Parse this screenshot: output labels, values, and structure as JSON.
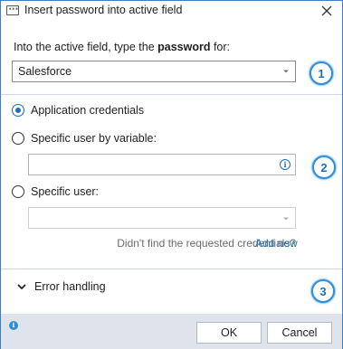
{
  "window": {
    "title": "Insert password into active field",
    "icon": "password-field-icon",
    "icon_glyph": "***"
  },
  "section1": {
    "prompt_prefix": "Into the active field, type the ",
    "prompt_bold": "password",
    "prompt_suffix": " for:",
    "selected_value": "Salesforce",
    "badge": "1"
  },
  "section2": {
    "options": [
      {
        "label": "Application credentials",
        "checked": true
      },
      {
        "label": "Specific user by variable:",
        "checked": false
      },
      {
        "label": "Specific user:",
        "checked": false
      }
    ],
    "variable_field_value": "",
    "user_select_value": "",
    "not_found_text": "Didn't find the requested credentials?",
    "add_new_label": "Add new",
    "badge": "2",
    "info_glyph": "i"
  },
  "section3": {
    "error_handling_label": "Error handling",
    "badge": "3"
  },
  "footer": {
    "info_glyph": "i",
    "ok_label": "OK",
    "cancel_label": "Cancel"
  },
  "colors": {
    "accent": "#1f6fb4",
    "border": "#3c7fc4",
    "footer_bg": "#dfe3ec"
  }
}
